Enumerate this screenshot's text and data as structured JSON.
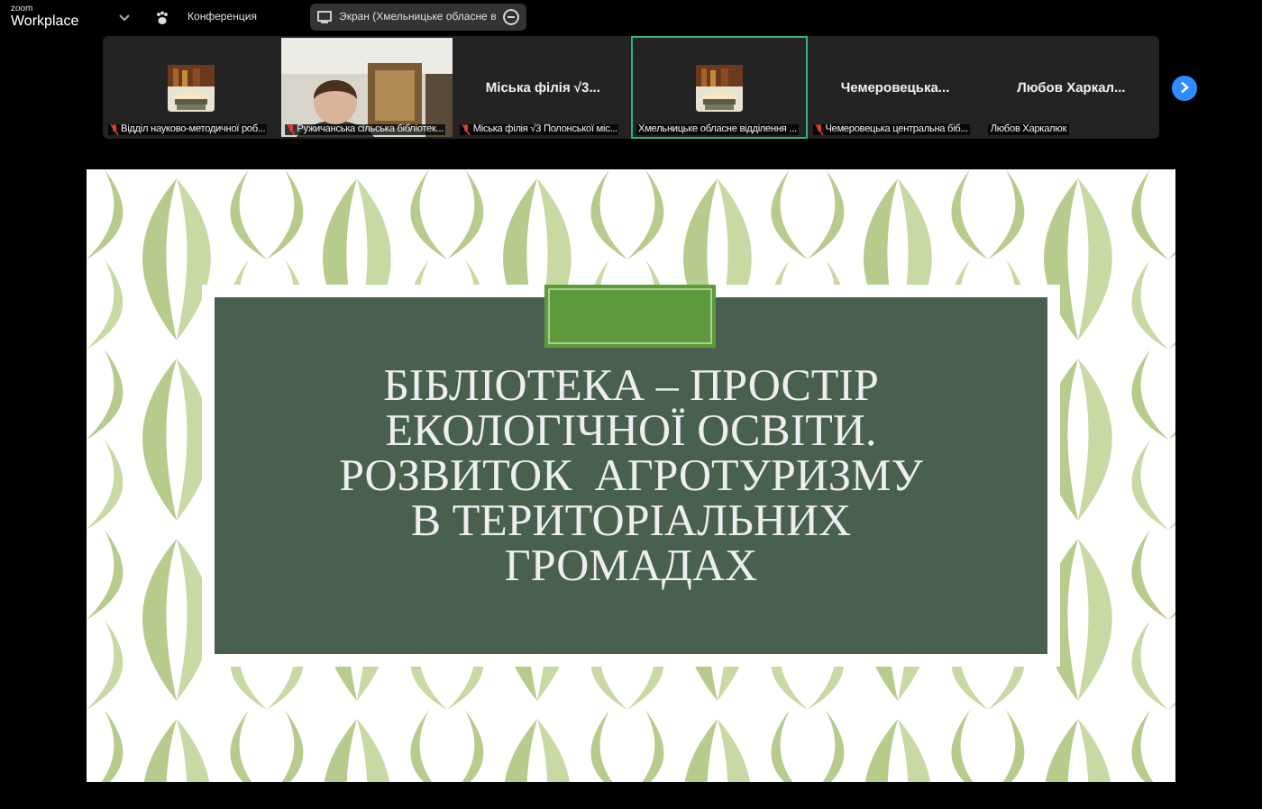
{
  "topbar": {
    "logo_top": "zoom",
    "logo_bottom": "Workplace",
    "meeting_label": "Конференция",
    "share_label": "Экран (Хмельницьке обласне в"
  },
  "tiles": [
    {
      "kind": "avatar",
      "caption": "Відділ науково-методичної роб...",
      "muted": true,
      "selected": false
    },
    {
      "kind": "video",
      "caption": "Ружичанська сільська бібліотек...",
      "muted": true,
      "selected": false
    },
    {
      "kind": "name",
      "name": "Міська філія √3...",
      "caption": "Міська філія √3 Полонської міс...",
      "muted": true,
      "selected": false
    },
    {
      "kind": "avatar",
      "caption": "Хмельницьке обласне відділення ...",
      "muted": false,
      "selected": true
    },
    {
      "kind": "name",
      "name": "Чемеровецька...",
      "caption": "Чемеровецька центральна біб...",
      "muted": true,
      "selected": false
    },
    {
      "kind": "name",
      "name": "Любов Харкал...",
      "caption": "Любов Харкалюк",
      "muted": false,
      "selected": false
    }
  ],
  "slide": {
    "title_lines": [
      "БІБЛІОТЕКА – ПРОСТІР",
      "ЕКОЛОГІЧНОЇ ОСВІТИ.",
      "РОЗВИТОК  АГРОТУРИЗМУ",
      "В ТЕРИТОРІАЛЬНИХ",
      "ГРОМАДАХ"
    ]
  }
}
